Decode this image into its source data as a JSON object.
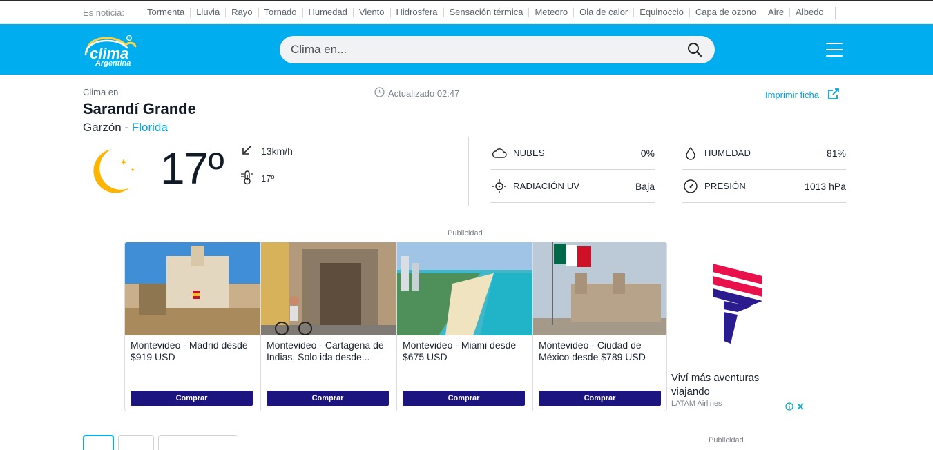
{
  "topbar": {
    "label": "Es noticia:",
    "links": [
      "Tormenta",
      "Lluvia",
      "Rayo",
      "Tornado",
      "Humedad",
      "Viento",
      "Hidrosfera",
      "Sensación térmica",
      "Meteoro",
      "Ola de calor",
      "Equinoccio",
      "Capa de ozono",
      "Aire",
      "Albedo"
    ]
  },
  "header": {
    "logo_text": "clima",
    "logo_sub": "Argentina",
    "search_placeholder": "Clima en...",
    "colors": {
      "brand": "#00aeef",
      "accent_link": "#00a3e0",
      "buy_button": "#1c1580"
    }
  },
  "location": {
    "intro": "Clima en",
    "city": "Sarandí Grande",
    "area": "Garzón",
    "separator": " - ",
    "province": "Florida",
    "updated": "Actualizado 02:47",
    "print": "Imprimir ficha"
  },
  "current": {
    "icon": "moon-icon",
    "temperature": "17º",
    "wind": "13km/h",
    "feels_like": "17º"
  },
  "stats": [
    {
      "icon": "cloud-icon",
      "name": "NUBES",
      "value": "0%"
    },
    {
      "icon": "drop-icon",
      "name": "HUMEDAD",
      "value": "81%"
    },
    {
      "icon": "sun-uv-icon",
      "name": "RADIACIÓN UV",
      "value": "Baja"
    },
    {
      "icon": "gauge-icon",
      "name": "PRESIÓN",
      "value": "1013 hPa"
    }
  ],
  "ads": {
    "label": "Publicidad",
    "cards": [
      {
        "title": "Montevideo - Madrid desde $919 USD",
        "button": "Comprar"
      },
      {
        "title": "Montevideo - Cartagena de Indias, Solo ida desde...",
        "button": "Comprar"
      },
      {
        "title": "Montevideo - Miami desde $675 USD",
        "button": "Comprar"
      },
      {
        "title": "Montevideo - Ciudad de México desde $789 USD",
        "button": "Comprar"
      }
    ],
    "side_title": "Viví más aventuras viajando",
    "side_sponsor": "LATAM Airlines"
  },
  "footer_ad_label": "Publicidad"
}
